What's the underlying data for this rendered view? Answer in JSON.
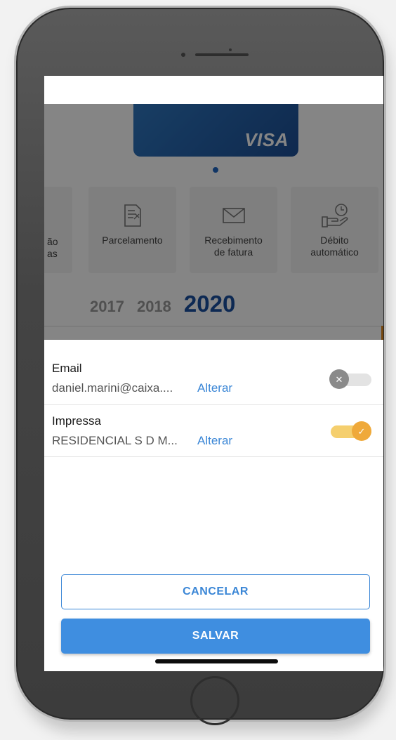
{
  "background": {
    "card": {
      "brand": "VISA"
    },
    "tiles": [
      {
        "partial_label": "ão\nas"
      },
      {
        "label": "Parcelamento",
        "icon": "document-edit-icon"
      },
      {
        "label": "Recebimento\nde fatura",
        "icon": "envelope-icon"
      },
      {
        "label": "Débito\nautomático",
        "icon": "hand-clock-icon"
      }
    ],
    "years": [
      "2017",
      "2018"
    ],
    "active_year": "2020"
  },
  "sheet": {
    "rows": [
      {
        "title": "Email",
        "value": "daniel.marini@caixa....",
        "link": "Alterar",
        "toggle_on": false
      },
      {
        "title": "Impressa",
        "value": "RESIDENCIAL S D M...",
        "link": "Alterar",
        "toggle_on": true
      }
    ],
    "cancel_label": "CANCELAR",
    "save_label": "SALVAR"
  },
  "colors": {
    "accent_blue": "#3a86d6",
    "save_button": "#3f8ee0",
    "year_active": "#1a4fa0",
    "toggle_on_knob": "#efa93a",
    "toggle_on_track": "#f5cf6e",
    "toggle_off_knob": "#8a8a8a"
  }
}
